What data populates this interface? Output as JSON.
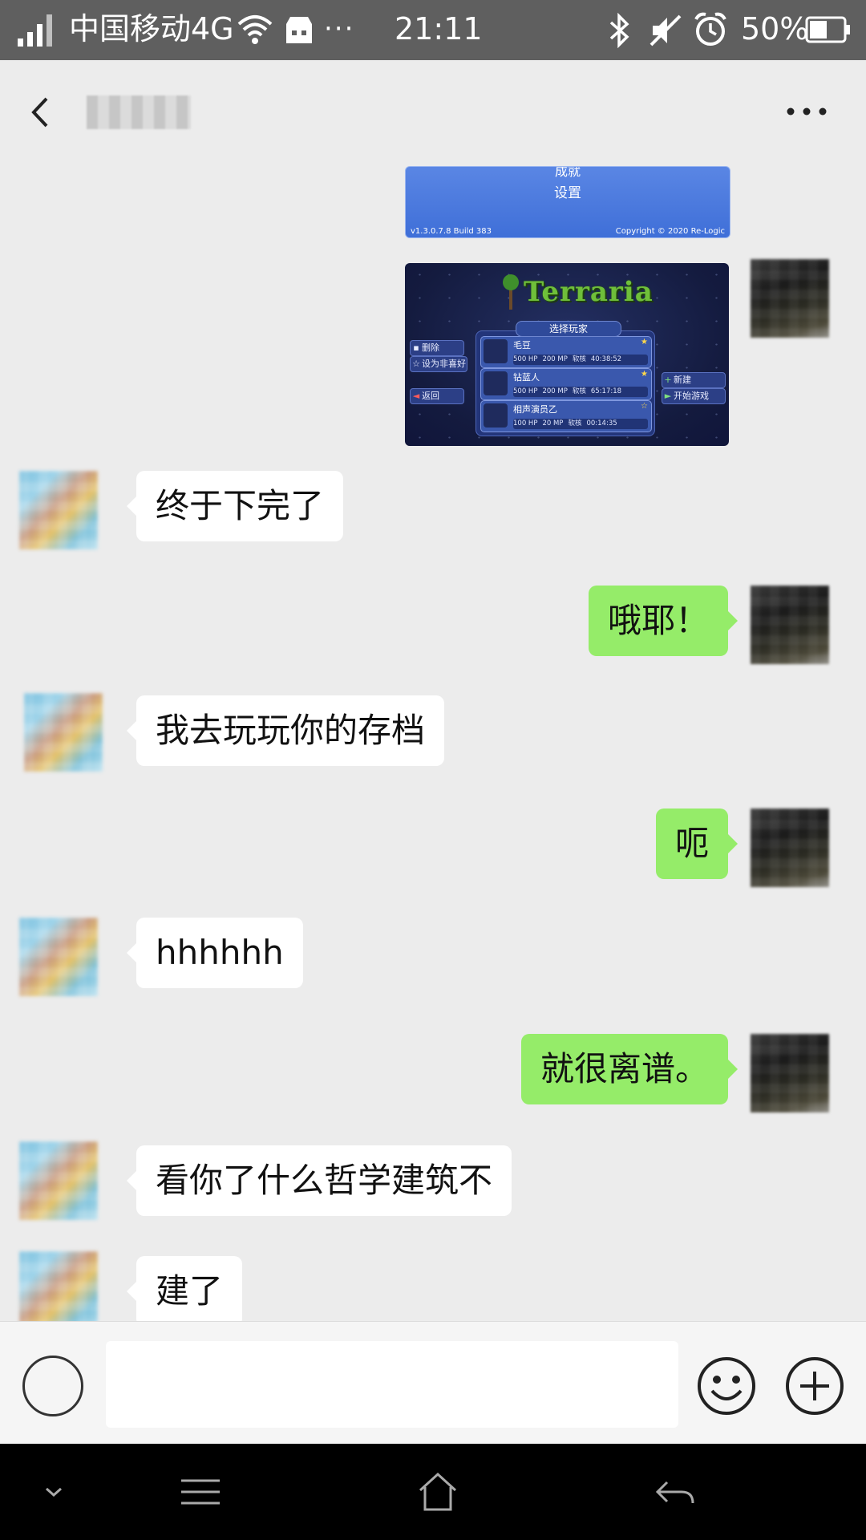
{
  "status_bar": {
    "carrier": "中国移动4G",
    "more": "···",
    "time": "21:11",
    "battery": "50%"
  },
  "header": {
    "back_icon": "back-arrow-icon",
    "more_icon": "more-dots-icon"
  },
  "shared_images": {
    "first": {
      "menu_top": "成就",
      "menu_item": "设置",
      "version": "v1.3.0.7.8 Build 383",
      "copyright": "Copyright © 2020 Re-Logic"
    },
    "second": {
      "logo": "Terraria",
      "panel_title": "选择玩家",
      "players": [
        {
          "name": "毛豆",
          "hp": "500 HP",
          "mp": "200 MP",
          "mode": "软核",
          "time": "40:38:52"
        },
        {
          "name": "钻蓝人",
          "hp": "500 HP",
          "mp": "200 MP",
          "mode": "软核",
          "time": "65:17:18"
        },
        {
          "name": "相声演员乙",
          "hp": "100 HP",
          "mp": "20 MP",
          "mode": "软核",
          "time": "00:14:35"
        }
      ],
      "left_buttons": [
        "删除",
        "设为非喜好",
        "返回"
      ],
      "right_buttons": [
        "新建",
        "开始游戏"
      ]
    }
  },
  "messages": [
    {
      "from": "friend",
      "text": "终于下完了"
    },
    {
      "from": "me",
      "text": "哦耶！"
    },
    {
      "from": "friend",
      "text": "我去玩玩你的存档"
    },
    {
      "from": "me",
      "text": "呃"
    },
    {
      "from": "friend",
      "text": "hhhhhh"
    },
    {
      "from": "me",
      "text": "就很离谱。"
    },
    {
      "from": "friend",
      "text": "看你了什么哲学建筑不"
    },
    {
      "from": "friend",
      "text": "建了"
    }
  ],
  "input_bar": {
    "voice_icon": "voice-icon",
    "emoji_icon": "emoji-icon",
    "plus_icon": "plus-icon",
    "text_value": ""
  },
  "nav_bar": {
    "icons": [
      "chevron-down-icon",
      "menu-icon",
      "home-icon",
      "back-icon"
    ]
  }
}
